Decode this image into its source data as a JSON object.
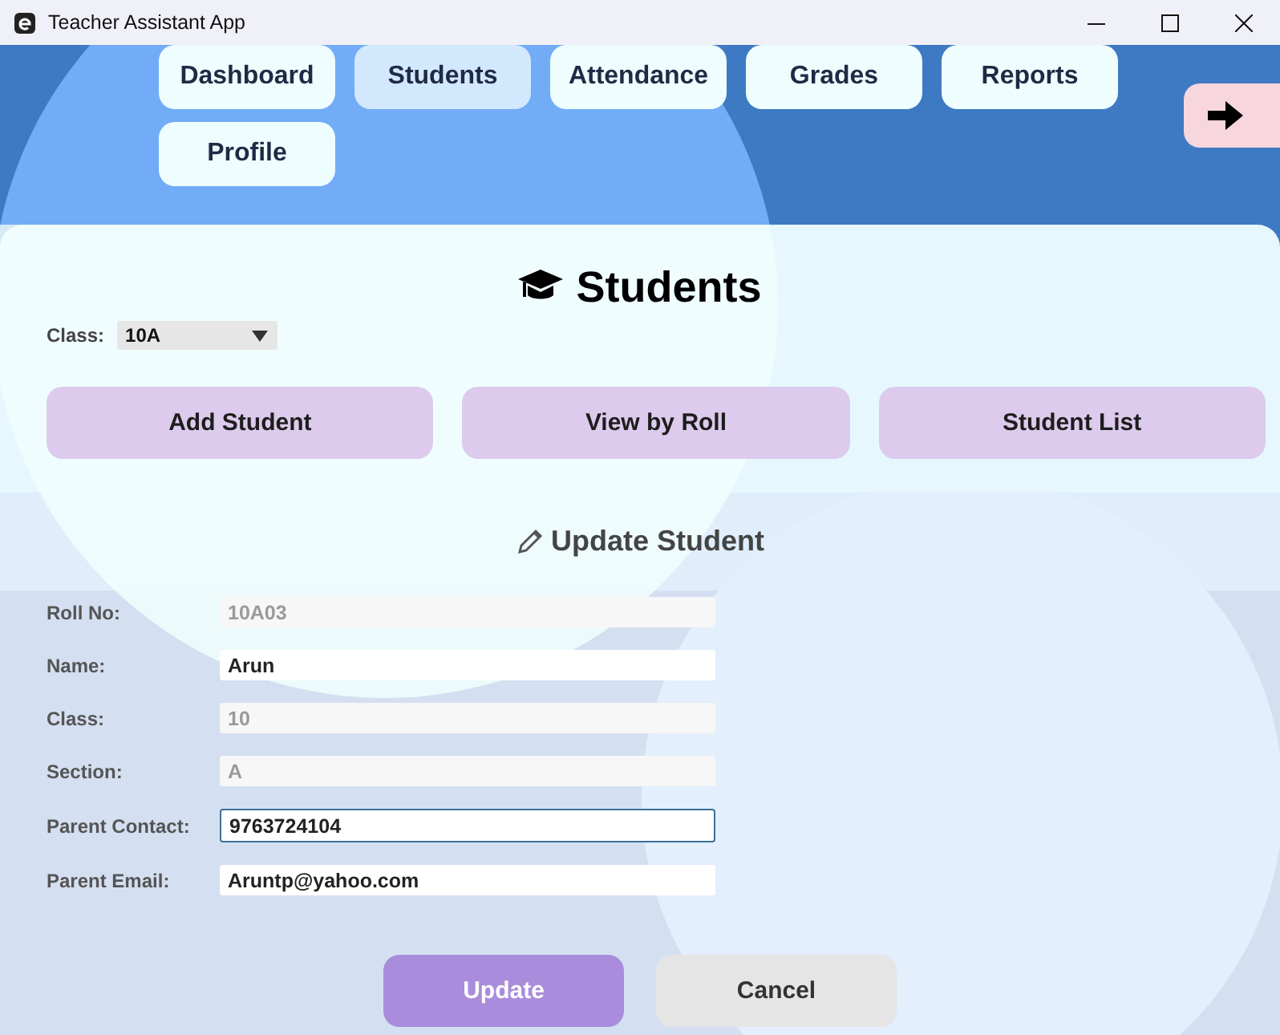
{
  "window": {
    "title": "Teacher Assistant App"
  },
  "nav": [
    {
      "label": "Dashboard",
      "selected": false
    },
    {
      "label": "Students",
      "selected": true
    },
    {
      "label": "Attendance",
      "selected": false
    },
    {
      "label": "Grades",
      "selected": false
    },
    {
      "label": "Reports",
      "selected": false
    },
    {
      "label": "Profile",
      "selected": false
    }
  ],
  "page": {
    "title": "Students",
    "class_label": "Class:",
    "class_value": "10A"
  },
  "actions": [
    "Add Student",
    "View by Roll",
    "Student List"
  ],
  "form": {
    "title": "Update Student",
    "fields": [
      {
        "label": "Roll No:",
        "value": "10A03",
        "disabled": true,
        "focused": false
      },
      {
        "label": "Name:",
        "value": "Arun",
        "disabled": false,
        "focused": false
      },
      {
        "label": "Class:",
        "value": "10",
        "disabled": true,
        "focused": false
      },
      {
        "label": "Section:",
        "value": "A",
        "disabled": true,
        "focused": false
      },
      {
        "label": "Parent Contact:",
        "value": "9763724104",
        "disabled": false,
        "focused": true
      },
      {
        "label": "Parent Email:",
        "value": "Aruntp@yahoo.com",
        "disabled": false,
        "focused": false
      }
    ],
    "buttons": [
      {
        "label": "Update",
        "kind": "primary"
      },
      {
        "label": "Cancel",
        "kind": "secondary"
      }
    ]
  }
}
